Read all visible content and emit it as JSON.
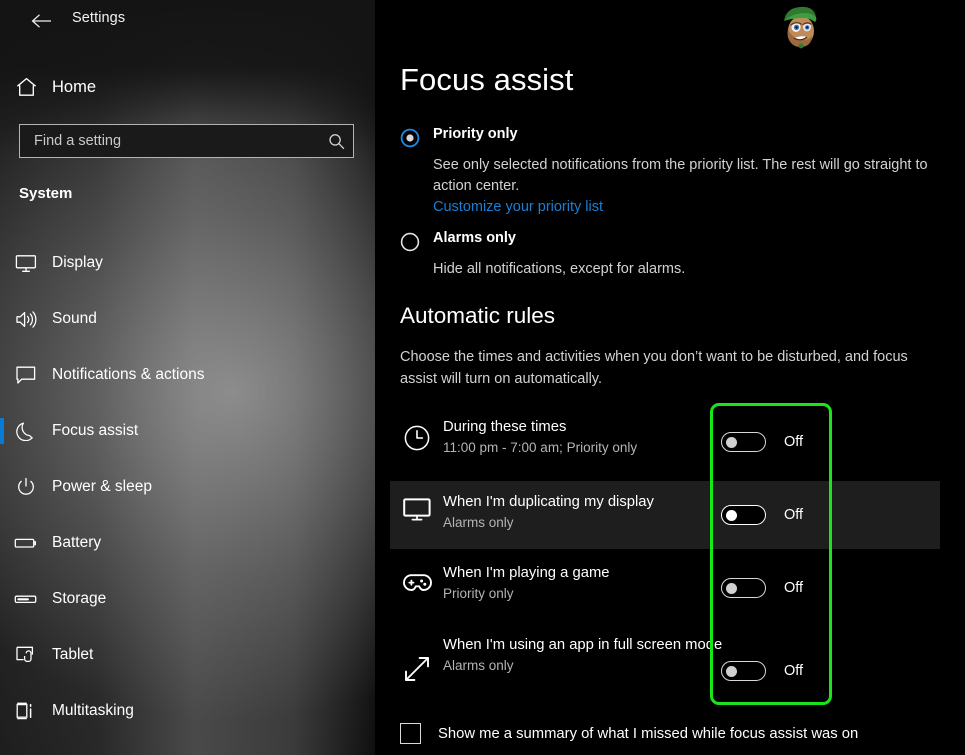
{
  "window": {
    "title": "Settings",
    "back_icon": "back-arrow-icon"
  },
  "sidebar": {
    "home": {
      "label": "Home",
      "icon": "home-icon"
    },
    "search": {
      "placeholder": "Find a setting",
      "value": "",
      "icon": "search-icon"
    },
    "section_label": "System",
    "selected": "Focus assist",
    "accent": "#0a7bd4",
    "items": [
      {
        "label": "Display",
        "icon": "monitor-icon",
        "selected": false
      },
      {
        "label": "Sound",
        "icon": "speaker-icon",
        "selected": false
      },
      {
        "label": "Notifications & actions",
        "icon": "speech-bubble-icon",
        "selected": false
      },
      {
        "label": "Focus assist",
        "icon": "moon-icon",
        "selected": true
      },
      {
        "label": "Power & sleep",
        "icon": "power-icon",
        "selected": false
      },
      {
        "label": "Battery",
        "icon": "battery-icon",
        "selected": false
      },
      {
        "label": "Storage",
        "icon": "storage-icon",
        "selected": false
      },
      {
        "label": "Tablet",
        "icon": "tablet-icon",
        "selected": false
      },
      {
        "label": "Multitasking",
        "icon": "multitasking-icon",
        "selected": false
      }
    ]
  },
  "main": {
    "page_title": "Focus assist",
    "modes": [
      {
        "label": "Priority only",
        "selected": true,
        "description": "See only selected notifications from the priority list. The rest will go straight to action center.",
        "link": "Customize your priority list",
        "link_color": "#1a7fd4"
      },
      {
        "label": "Alarms only",
        "selected": false,
        "description": "Hide all notifications, except for alarms.",
        "link": "",
        "link_color": ""
      }
    ],
    "rules": {
      "title": "Automatic rules",
      "description": "Choose the times and activities when you don’t want to be disturbed, and focus assist will turn on automatically.",
      "items": [
        {
          "name": "During these times",
          "sub": "11:00 pm - 7:00 am; Priority only",
          "icon": "clock-icon",
          "toggle_state": "Off",
          "toggle_on": false,
          "hovered": false
        },
        {
          "name": "When I'm duplicating my display",
          "sub": "Alarms only",
          "icon": "monitor-icon",
          "toggle_state": "Off",
          "toggle_on": false,
          "hovered": true
        },
        {
          "name": "When I'm playing a game",
          "sub": "Priority only",
          "icon": "gamepad-icon",
          "toggle_state": "Off",
          "toggle_on": false,
          "hovered": false
        },
        {
          "name": "When I'm using an app in full screen mode",
          "sub": "Alarms only",
          "icon": "fullscreen-arrows-icon",
          "toggle_state": "Off",
          "toggle_on": false,
          "hovered": false
        }
      ]
    },
    "summary": {
      "label": "Show me a summary of what I missed while focus assist was on",
      "checked": false
    }
  },
  "annotation": {
    "type": "highlight-rectangle",
    "color": "#19e619",
    "target": "automatic-rules-toggle-column"
  },
  "watermark": {
    "name": "cartoon-face-watermark"
  }
}
